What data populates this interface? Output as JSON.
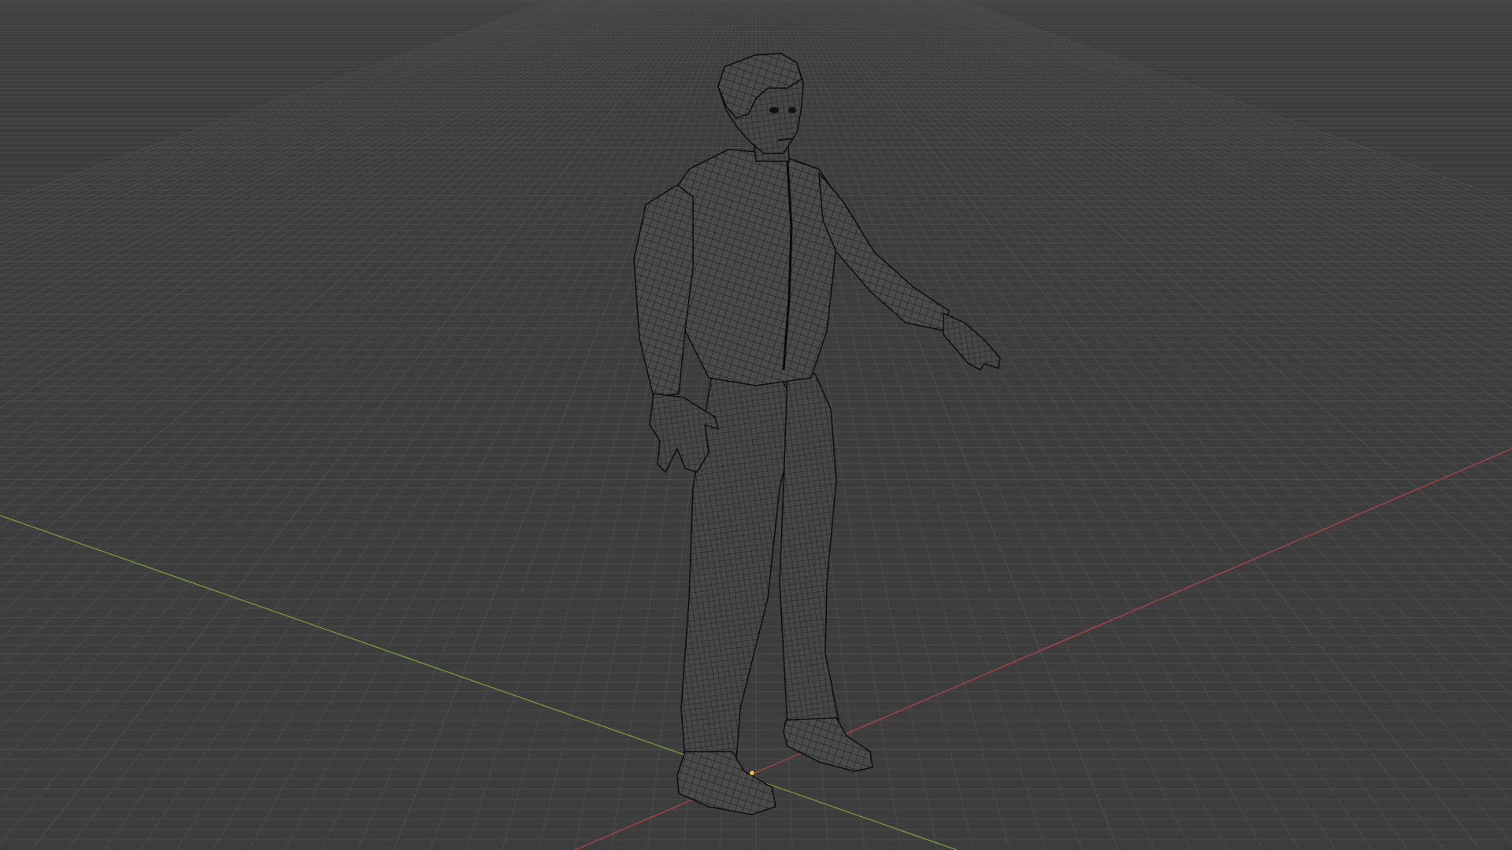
{
  "viewport": {
    "background": "#3d3d3d",
    "grid_color": "#555555",
    "grid_major_color": "#5e5e5e",
    "x_axis_color": "#b8404c",
    "y_axis_color": "#7fa03a",
    "origin_color": "#f2b94a"
  },
  "scene": {
    "object_mode": "wireframe",
    "object_type": "human-figure",
    "wire_color": "#111111",
    "fill_color": "#4a4a4a"
  }
}
